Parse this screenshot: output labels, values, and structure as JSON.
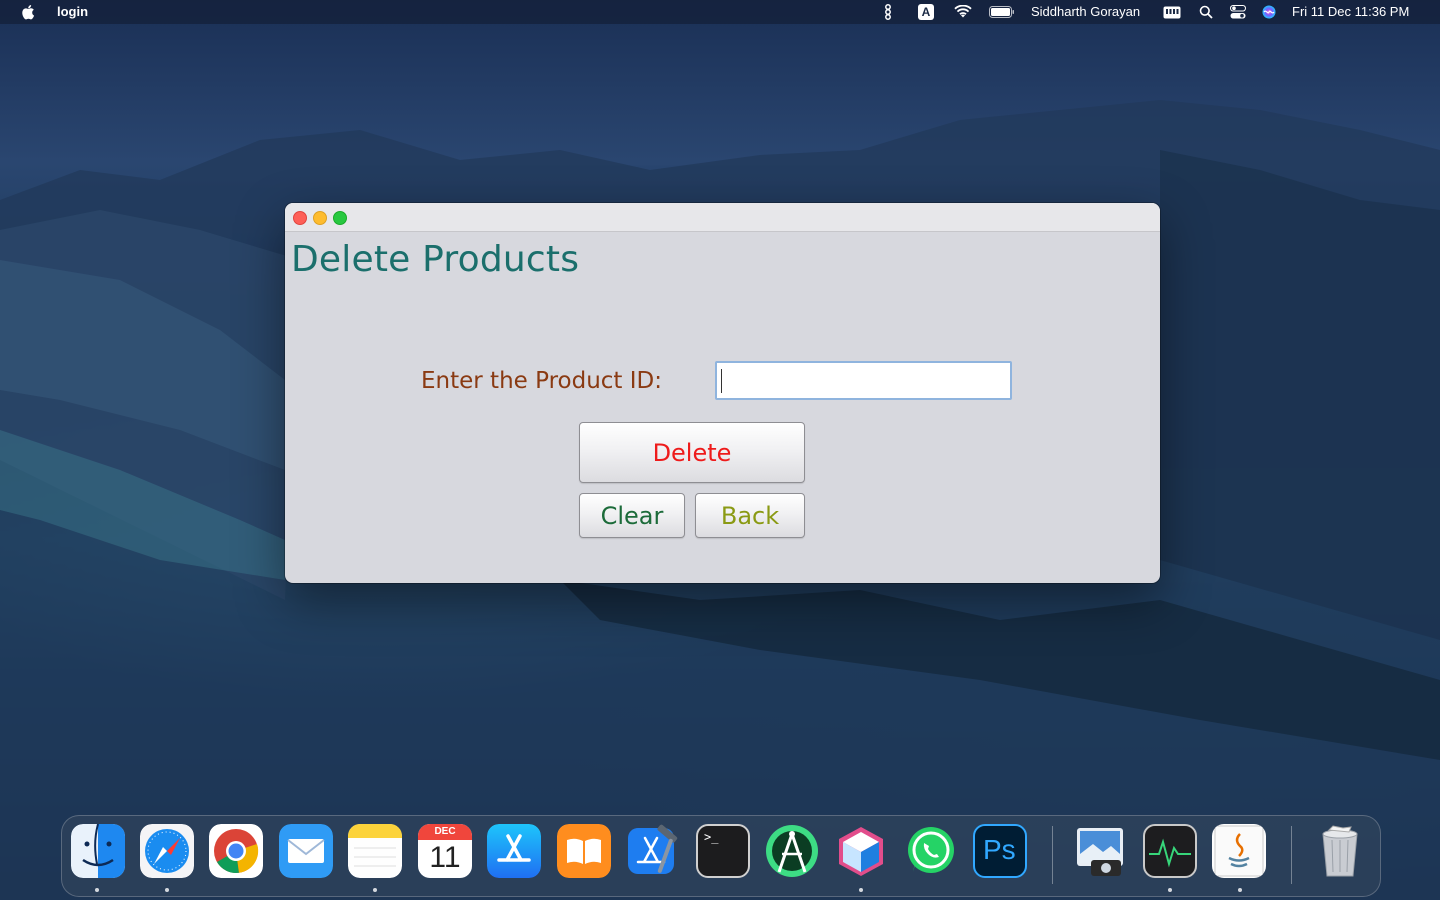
{
  "menubar": {
    "app_name": "login",
    "user_name": "Siddharth Gorayan",
    "datetime": "Fri 11 Dec  11:36 PM",
    "input_source": "A",
    "icons": [
      "apple-icon",
      "script-editor-icon",
      "input-source-icon",
      "wifi-icon",
      "battery-icon",
      "keyboard-icon",
      "spotlight-icon",
      "control-center-icon",
      "siri-icon"
    ]
  },
  "window": {
    "title": "",
    "heading": "Delete Products",
    "product_id_label": "Enter the Product ID:",
    "product_id_value": "",
    "delete_label": "Delete",
    "clear_label": "Clear",
    "back_label": "Back"
  },
  "colors": {
    "heading": "#1b6f6c",
    "label": "#8a3a12",
    "delete": "#ee1b1b",
    "clear": "#1c6b3a",
    "back": "#8a9a14"
  },
  "dock": {
    "calendar_month": "DEC",
    "calendar_day": "11",
    "terminal_prompt": ">_",
    "photoshop_label": "Ps",
    "apps": [
      "finder",
      "safari",
      "chrome",
      "mail",
      "notes",
      "calendar",
      "app-store",
      "books",
      "xcode",
      "terminal",
      "android-studio",
      "box-app",
      "whatsapp",
      "photoshop",
      "preview",
      "activity-monitor",
      "java",
      "trash"
    ]
  }
}
